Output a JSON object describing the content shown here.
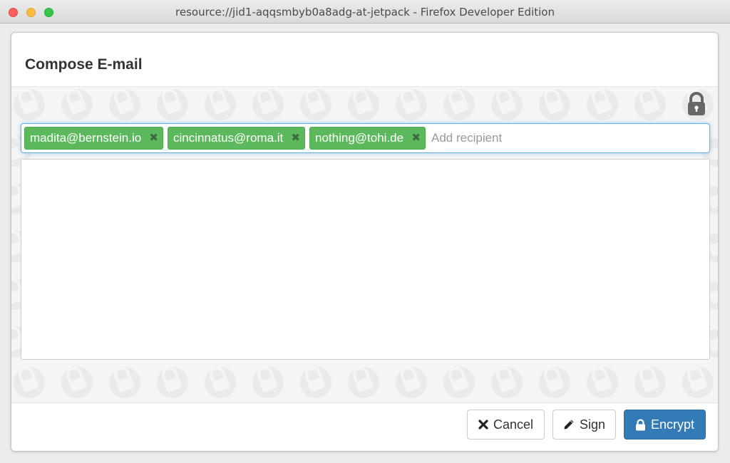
{
  "window": {
    "title": "resource://jid1-aqqsmbyb0a8adg-at-jetpack - Firefox Developer Edition"
  },
  "dialog": {
    "title": "Compose E-mail"
  },
  "recipients": {
    "tags": [
      {
        "email": "madita@bernstein.io",
        "remove_icon": "remove-icon"
      },
      {
        "email": "cincinnatus@roma.it",
        "remove_icon": "remove-icon"
      },
      {
        "email": "nothing@tohi.de",
        "remove_icon": "remove-icon"
      }
    ],
    "input_placeholder": "Add recipient",
    "input_value": ""
  },
  "message": {
    "value": ""
  },
  "footer": {
    "cancel_label": "Cancel",
    "sign_label": "Sign",
    "encrypt_label": "Encrypt"
  },
  "colors": {
    "tag_bg": "#5cb85c",
    "primary": "#337ab7",
    "focus": "#66afe9"
  },
  "icons": {
    "secure": "lock-icon",
    "cancel": "times-icon",
    "sign": "pencil-icon",
    "encrypt": "lock-icon"
  }
}
